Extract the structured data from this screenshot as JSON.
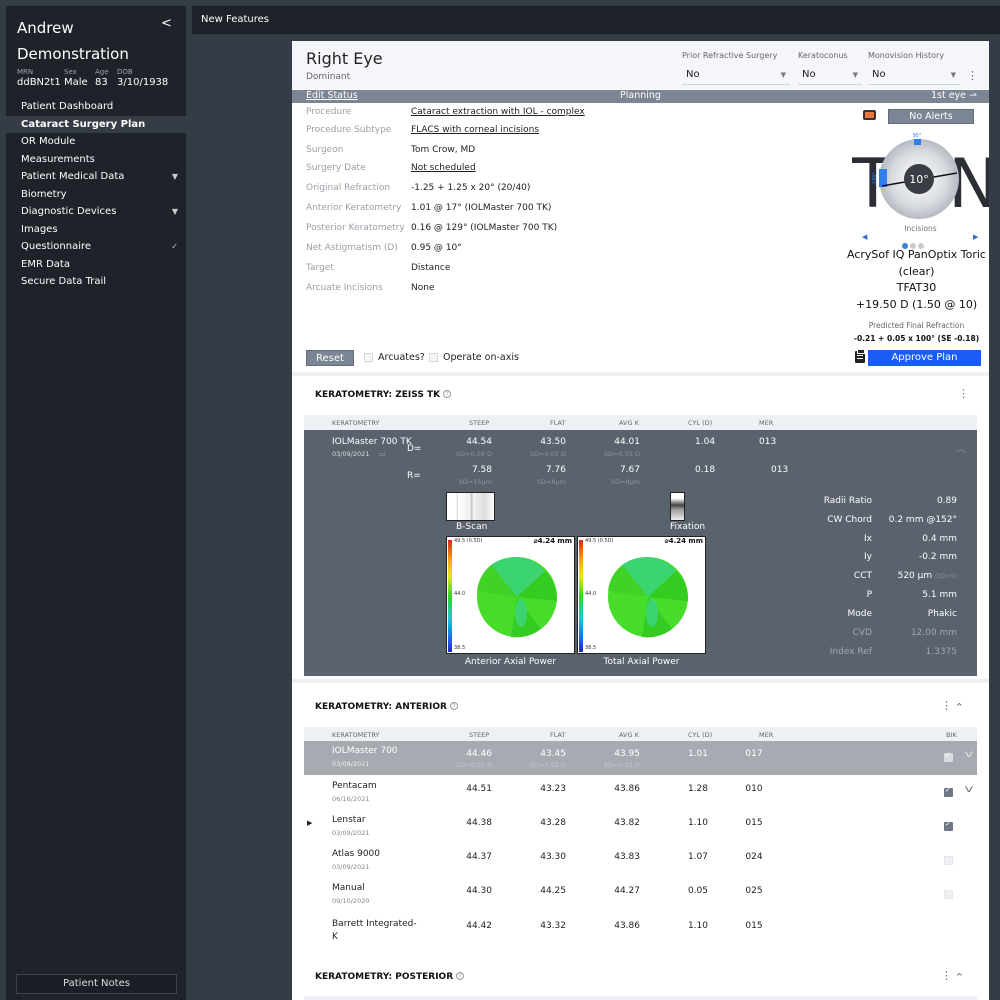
{
  "sidebar": {
    "patient_first": "Andrew",
    "patient_last": "Demonstration",
    "collapse_icon": "chevron-left-icon",
    "meta": [
      {
        "label": "MRN",
        "value": "ddBN2t1"
      },
      {
        "label": "Sex",
        "value": "Male"
      },
      {
        "label": "Age",
        "value": "83"
      },
      {
        "label": "DOB",
        "value": "3/10/1938"
      }
    ],
    "items": [
      {
        "label": "Patient Dashboard",
        "icon": ""
      },
      {
        "label": "Cataract Surgery Plan",
        "icon": "",
        "active": true
      },
      {
        "label": "OR Module",
        "icon": ""
      },
      {
        "label": "Measurements",
        "icon": ""
      },
      {
        "label": "Patient Medical Data",
        "icon": "▼"
      },
      {
        "label": "Biometry",
        "icon": ""
      },
      {
        "label": "Diagnostic Devices",
        "icon": "▼"
      },
      {
        "label": "Images",
        "icon": ""
      },
      {
        "label": "Questionnaire",
        "icon": "✓"
      },
      {
        "label": "EMR Data",
        "icon": ""
      },
      {
        "label": "Secure Data Trail",
        "icon": ""
      }
    ],
    "patient_notes": "Patient Notes"
  },
  "topbar": {
    "title": "New Features"
  },
  "eye": {
    "title": "Right Eye",
    "subtitle": "Dominant",
    "dropdowns": [
      {
        "label": "Prior Refractive Surgery",
        "value": "No"
      },
      {
        "label": "Keratoconus",
        "value": "No"
      },
      {
        "label": "Monovision History",
        "value": "No"
      }
    ],
    "status": {
      "edit": "Edit Status",
      "state": "Planning",
      "order": "1st eye ⇀"
    },
    "info": [
      {
        "key": "Procedure",
        "value": "Cataract extraction with IOL - complex",
        "link": true
      },
      {
        "key": "Procedure Subtype",
        "value": "FLACS with corneal incisions",
        "link": true
      },
      {
        "key": "Surgeon",
        "value": "Tom Crow, MD",
        "link": false
      },
      {
        "key": "Surgery Date",
        "value": "Not scheduled",
        "link": true
      },
      {
        "key": "Original Refraction",
        "value": "-1.25 + 1.25 x 20° (20/40)",
        "link": false
      },
      {
        "key": "Anterior Keratometry",
        "value": "1.01 @ 17° (IOLMaster 700 TK)",
        "link": false
      },
      {
        "key": "Posterior Keratometry",
        "value": "0.16 @ 129° (IOLMaster 700 TK)",
        "link": false
      },
      {
        "key": "Net Astigmatism (D)",
        "value": "0.95 @ 10°",
        "link": false
      },
      {
        "key": "Target",
        "value": "Distance",
        "link": false
      },
      {
        "key": "Arcuate Incisions",
        "value": "None",
        "link": false
      }
    ],
    "reset_label": "Reset",
    "arcuates_label": "Arcuates?",
    "on_axis_label": "Operate on-axis",
    "alerts_label": "No Alerts",
    "ton": {
      "left": "T",
      "right": "N",
      "axis": "10°",
      "mark_top": "95°",
      "mark_left": "180°",
      "incisions_label": "Incisions"
    },
    "lens": {
      "name": "AcrySof IQ PanOptix Toric",
      "variant": "(clear)",
      "model": "TFAT30",
      "power": "+19.50 D (1.50 @ 10)"
    },
    "pfr_label": "Predicted Final Refraction",
    "pfr_value": "-0.21 + 0.05 x 100° (SE -0.18)",
    "approve_label": "Approve Plan"
  },
  "zeiss": {
    "title": "KERATOMETRY: ZEISS TK",
    "headers": [
      "KERATOMETRY",
      "STEEP",
      "FLAT",
      "AVG K",
      "CYL (D)",
      "MER"
    ],
    "device": "IOLMaster 700 TK",
    "date": "03/09/2021",
    "d_label": "D=",
    "r_label": "R=",
    "d_row": {
      "steep": "44.54",
      "flat": "43.50",
      "avg": "44.01",
      "cyl": "1.04",
      "mer": "013",
      "sd_steep": "SD=0.09 D",
      "sd_flat": "SD=0.05 D",
      "sd_avg": "SD=0.05 D"
    },
    "r_row": {
      "steep": "7.58",
      "flat": "7.76",
      "avg": "7.67",
      "cyl": "0.18",
      "mer": "013",
      "sd_steep": "SD=15μm",
      "sd_flat": "SD=8μm",
      "sd_avg": "SD=8μm"
    },
    "bscan_label": "B-Scan",
    "fixation_label": "Fixation",
    "maps": [
      {
        "label": "Anterior Axial Power",
        "top": "49.5 (0.5D)",
        "mid": "44.0",
        "bottom": "38.5",
        "diameter": "⌀4.24 mm"
      },
      {
        "label": "Total Axial Power",
        "top": "49.5 (0.5D)",
        "mid": "44.0",
        "bottom": "38.5",
        "diameter": "⌀4.24 mm"
      }
    ],
    "stats": [
      {
        "key": "Radii Ratio",
        "value": "0.89",
        "dim": false
      },
      {
        "key": "CW Chord",
        "value": "0.2 mm @152°",
        "dim": false
      },
      {
        "key": "Ix",
        "value": "0.4 mm",
        "dim": false
      },
      {
        "key": "Iy",
        "value": "-0.2 mm",
        "dim": false
      },
      {
        "key": "CCT",
        "value": "520 μm",
        "extra": "(SD=5)",
        "dim": false
      },
      {
        "key": "P",
        "value": "5.1 mm",
        "dim": false
      },
      {
        "key": "Mode",
        "value": "Phakic",
        "dim": false
      },
      {
        "key": "CVD",
        "value": "12.00 mm",
        "dim": true
      },
      {
        "key": "Index Ref",
        "value": "1.3375",
        "dim": true
      }
    ]
  },
  "anterior": {
    "title": "KERATOMETRY: ANTERIOR",
    "headers": [
      "KERATOMETRY",
      "STEEP",
      "FLAT",
      "AVG K",
      "CYL (D)",
      "MER",
      "BIK"
    ],
    "rows": [
      {
        "name": "IOLMaster 700",
        "date": "03/09/2021",
        "steep": "44.46",
        "flat": "43.45",
        "avg": "43.95",
        "cyl": "1.01",
        "mer": "017",
        "sd": "SD=0.02 D",
        "bik": true,
        "highlight": true
      },
      {
        "name": "Pentacam",
        "date": "06/16/2021",
        "steep": "44.51",
        "flat": "43.23",
        "avg": "43.86",
        "cyl": "1.28",
        "mer": "010",
        "bik": true
      },
      {
        "name": "Lenstar",
        "date": "03/09/2021",
        "steep": "44.38",
        "flat": "43.28",
        "avg": "43.82",
        "cyl": "1.10",
        "mer": "015",
        "bik": true
      },
      {
        "name": "Atlas 9000",
        "date": "03/09/2021",
        "steep": "44.37",
        "flat": "43.30",
        "avg": "43.83",
        "cyl": "1.07",
        "mer": "024",
        "bik": false
      },
      {
        "name": "Manual",
        "date": "09/10/2020",
        "steep": "44.30",
        "flat": "44.25",
        "avg": "44.27",
        "cyl": "0.05",
        "mer": "025",
        "bik": false
      },
      {
        "name": "Barrett Integrated-K",
        "date": "",
        "steep": "44.42",
        "flat": "43.32",
        "avg": "43.86",
        "cyl": "1.10",
        "mer": "015",
        "bik": null
      }
    ]
  },
  "posterior": {
    "title": "KERATOMETRY: POSTERIOR"
  },
  "colors": {
    "accent": "#1a5df5",
    "sidebar": "#1e2229",
    "status_bar": "#7c8594",
    "tk_block": "#5a626d",
    "alert_monitor": "#e8763d"
  }
}
